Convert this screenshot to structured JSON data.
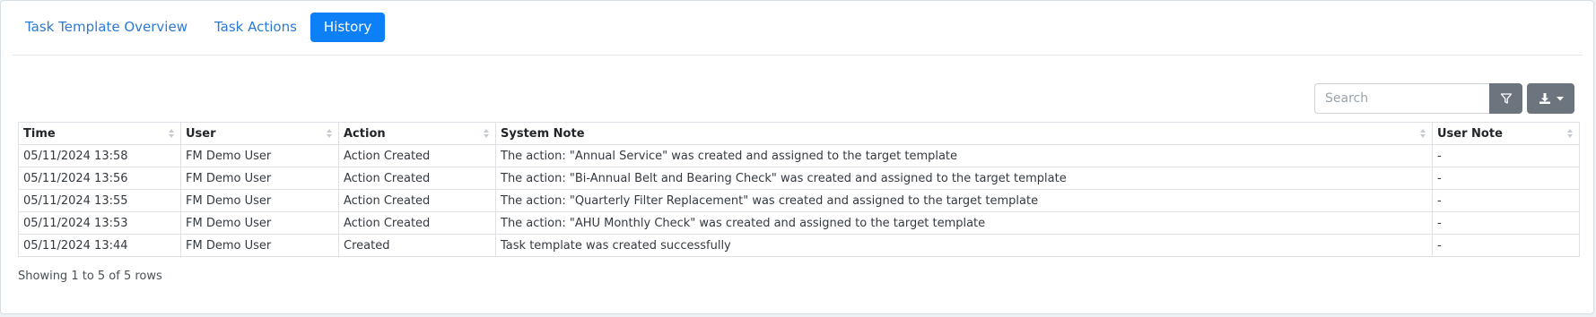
{
  "tabs": [
    {
      "label": "Task Template Overview",
      "active": false
    },
    {
      "label": "Task Actions",
      "active": false
    },
    {
      "label": "History",
      "active": true
    }
  ],
  "toolbar": {
    "search_placeholder": "Search",
    "search_value": "",
    "filter_icon": "filter-icon",
    "export_icon": "download-icon"
  },
  "table": {
    "columns": [
      "Time",
      "User",
      "Action",
      "System Note",
      "User Note"
    ],
    "rows": [
      [
        "05/11/2024 13:58",
        "FM Demo User",
        "Action Created",
        "The action: \"Annual Service\" was created and assigned to the target template",
        "-"
      ],
      [
        "05/11/2024 13:56",
        "FM Demo User",
        "Action Created",
        "The action: \"Bi-Annual Belt and Bearing Check\" was created and assigned to the target template",
        "-"
      ],
      [
        "05/11/2024 13:55",
        "FM Demo User",
        "Action Created",
        "The action: \"Quarterly Filter Replacement\" was created and assigned to the target template",
        "-"
      ],
      [
        "05/11/2024 13:53",
        "FM Demo User",
        "Action Created",
        "The action: \"AHU Monthly Check\" was created and assigned to the target template",
        "-"
      ],
      [
        "05/11/2024 13:44",
        "FM Demo User",
        "Created",
        "Task template was created successfully",
        "-"
      ]
    ]
  },
  "footer": {
    "summary": "Showing 1 to 5 of 5 rows"
  },
  "colors": {
    "accent": "#0d7ff7",
    "link": "#2b7bd6",
    "button_gray": "#6c757d"
  }
}
